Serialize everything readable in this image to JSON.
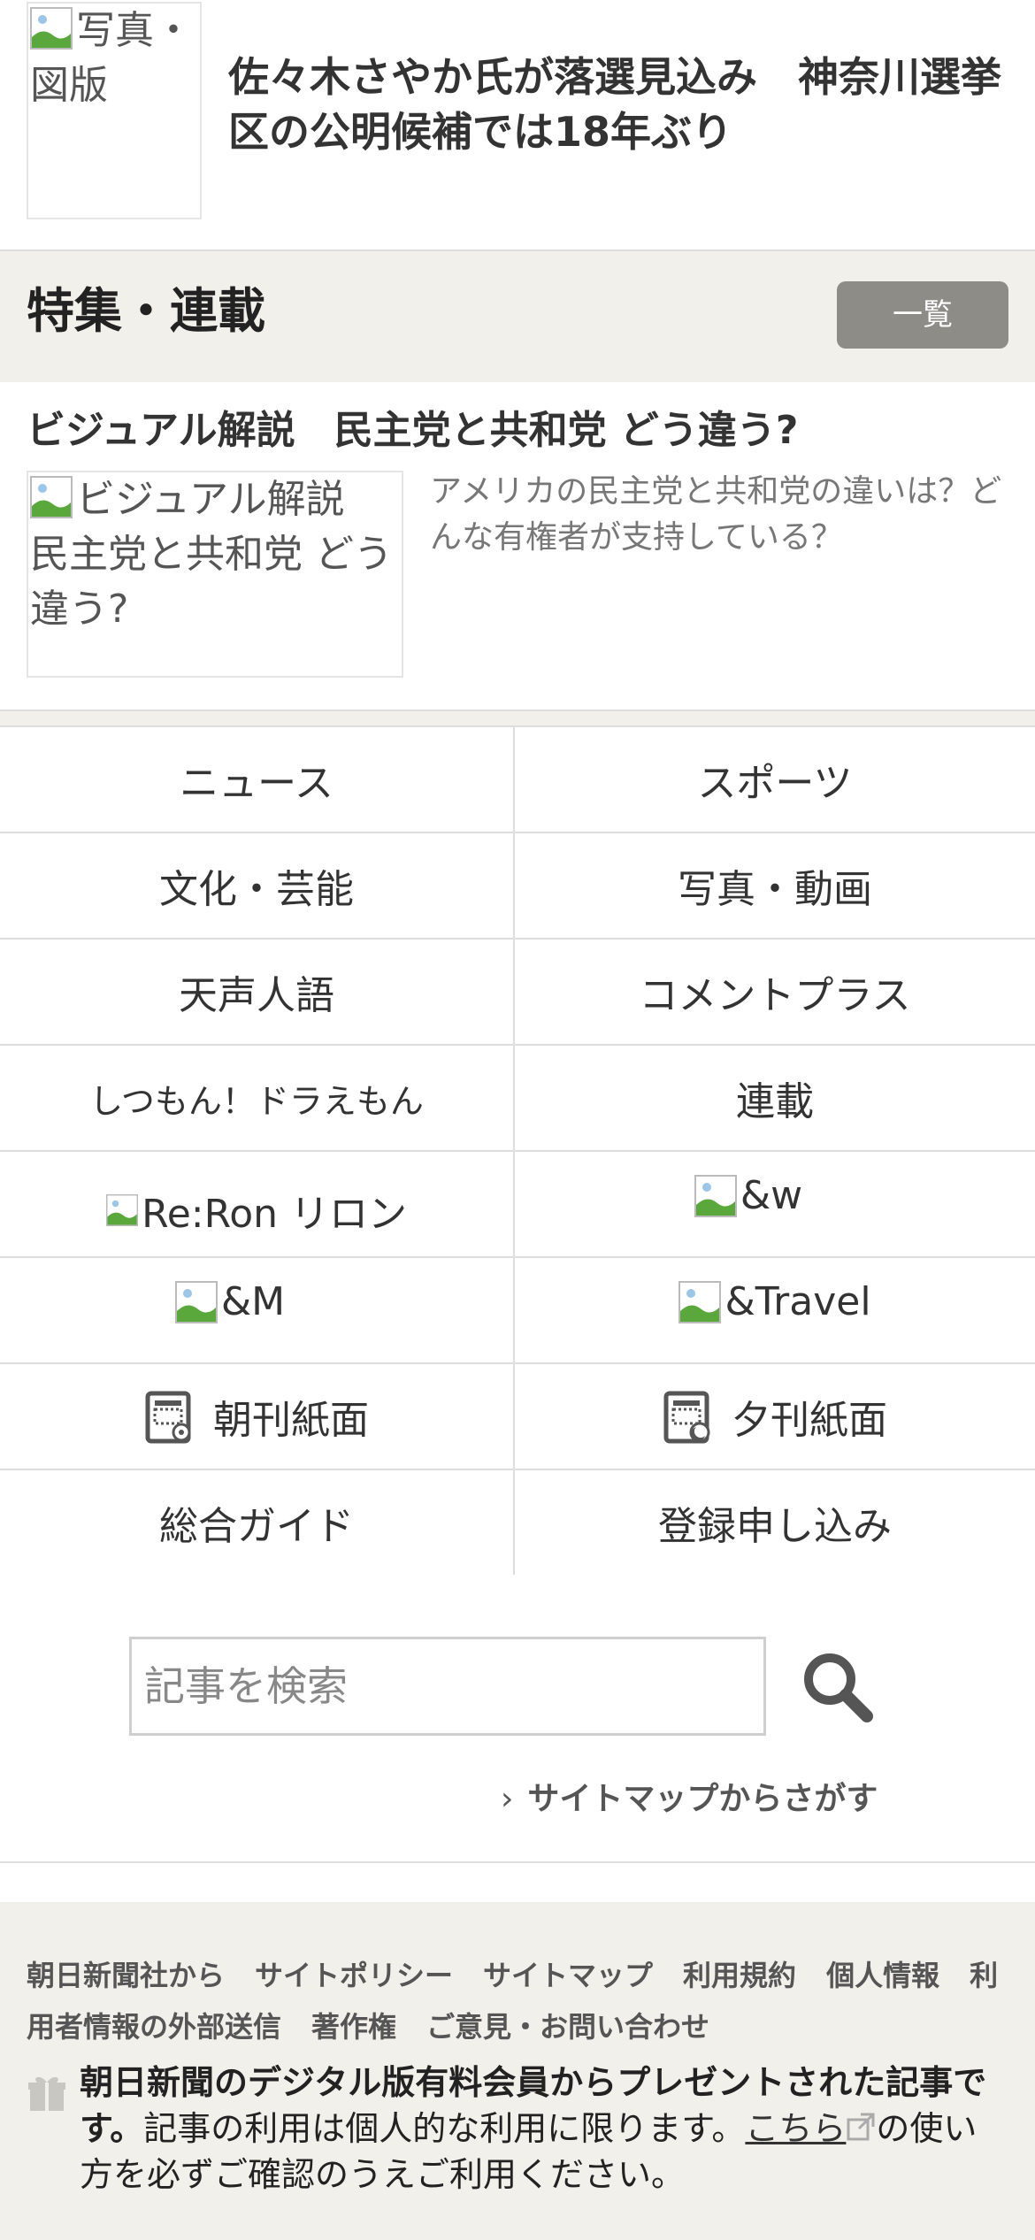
{
  "top_article": {
    "thumb_alt": "写真・図版",
    "title": "佐々木さやか氏が落選見込み　神奈川選挙区の公明候補では18年ぶり"
  },
  "feature": {
    "heading": "特集・連載",
    "list_button": "一覧",
    "item": {
      "title": "ビジュアル解説　民主党と共和党 どう違う?",
      "thumb_alt": "ビジュアル解説　民主党と共和党 どう違う?",
      "description": "アメリカの民主党と共和党の違いは？どんな有権者が支持している？"
    }
  },
  "nav": {
    "news": "ニュース",
    "sports": "スポーツ",
    "culture": "文化・芸能",
    "photo_video": "写真・動画",
    "tensei_jingo": "天声人語",
    "comment_plus": "コメントプラス",
    "doraemon": "しつもん！ドラえもん",
    "series": "連載",
    "reron": "Re:Ron リロン",
    "and_w": "&w",
    "and_m": "&M",
    "and_travel": "&Travel",
    "morning_paper": "朝刊紙面",
    "evening_paper": "夕刊紙面",
    "guide": "総合ガイド",
    "register": "登録申し込み"
  },
  "search": {
    "placeholder": "記事を検索",
    "sitemap_link": "サイトマップからさがす"
  },
  "footer": {
    "links": [
      "朝日新聞社から",
      "サイトポリシー",
      "サイトマップ",
      "利用規約",
      "個人情報",
      "利用者情報の外部送信",
      "著作権",
      "ご意見・お問い合わせ"
    ],
    "gift_bold": "朝日新聞のデジタル版有料会員からプレゼントされた記事です。",
    "gift_text_1": "記事の利用は個人的な利用に限ります。",
    "gift_link": "こちら",
    "gift_text_2": "の使い方を必ずご確認のうえご利用ください。"
  },
  "colors": {
    "feature_bg": "#f2f0eb",
    "button_bg": "#8e8c87",
    "border": "#dddddd",
    "text": "#333333"
  }
}
